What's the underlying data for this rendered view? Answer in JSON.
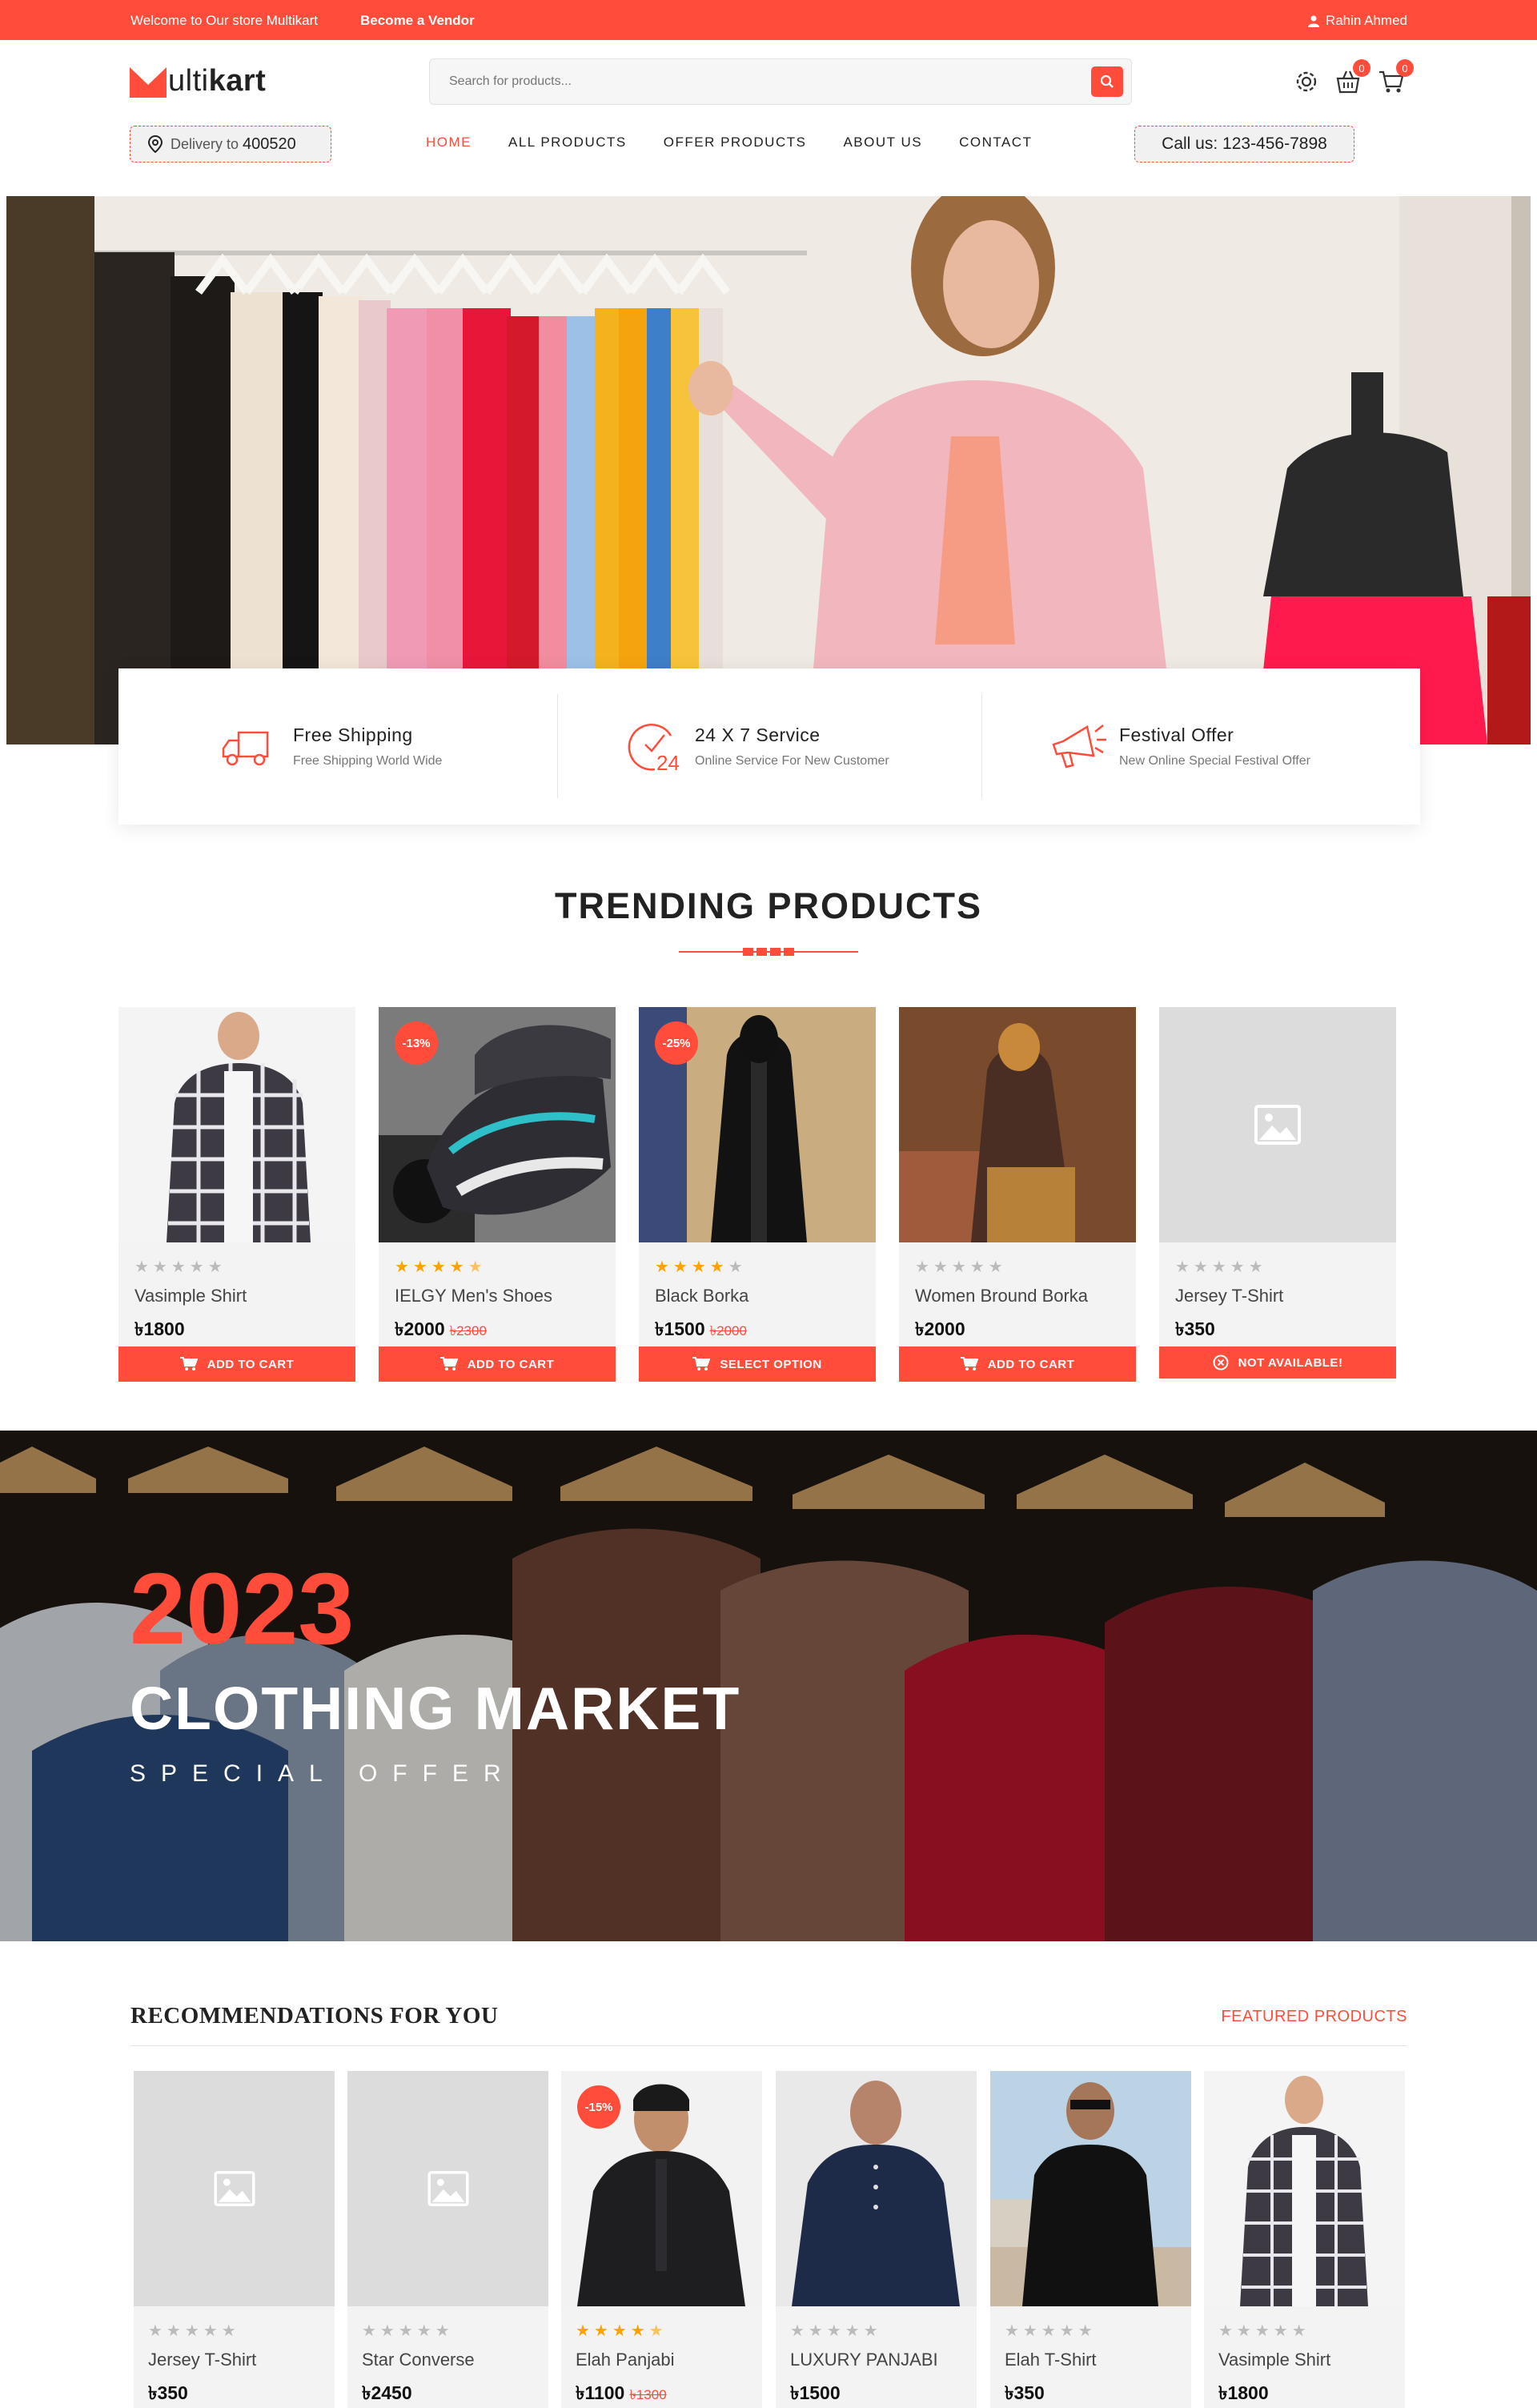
{
  "topbar": {
    "welcome": "Welcome to Our store Multikart",
    "vendor": "Become a Vendor",
    "user": "Rahin Ahmed"
  },
  "header": {
    "logo_mark": "M",
    "logo_text_light": "ulti",
    "logo_text_bold": "kart",
    "search_placeholder": "Search for products...",
    "wishlist_count": "0",
    "cart_count": "0",
    "delivery_label": "Delivery to",
    "delivery_code": "400520",
    "call": "Call us: 123-456-7898"
  },
  "nav": [
    "HOME",
    "ALL PRODUCTS",
    "OFFER PRODUCTS",
    "ABOUT US",
    "CONTACT"
  ],
  "services": [
    {
      "title": "Free Shipping",
      "sub": "Free Shipping World Wide",
      "icon": "truck-icon"
    },
    {
      "title": "24 X 7 Service",
      "sub": "Online Service For New Customer",
      "icon": "clock-24-icon"
    },
    {
      "title": "Festival Offer",
      "sub": "New Online Special Festival Offer",
      "icon": "megaphone-icon"
    }
  ],
  "trending": {
    "title": "TRENDING PRODUCTS",
    "products": [
      {
        "name": "Vasimple Shirt",
        "price": "৳1800",
        "old": "",
        "discount": "",
        "rating": 0,
        "action": "ADD TO CART"
      },
      {
        "name": "IELGY Men's Shoes",
        "price": "৳2000",
        "old": "৳2300",
        "discount": "-13%",
        "rating": 4.5,
        "action": "ADD TO CART"
      },
      {
        "name": "Black Borka",
        "price": "৳1500",
        "old": "৳2000",
        "discount": "-25%",
        "rating": 4,
        "action": "SELECT OPTION"
      },
      {
        "name": "Women Bround Borka",
        "price": "৳2000",
        "old": "",
        "discount": "",
        "rating": 0,
        "action": "ADD TO CART"
      },
      {
        "name": "Jersey T-Shirt",
        "price": "৳350",
        "old": "",
        "discount": "",
        "rating": 0,
        "action": "NOT AVAILABLE!"
      }
    ]
  },
  "banner": {
    "year": "2023",
    "title": "CLOTHING MARKET",
    "subtitle": "SPECIAL OFFER"
  },
  "recommendations": {
    "title": "RECOMMENDATIONS FOR YOU",
    "featured": "FEATURED PRODUCTS",
    "products": [
      {
        "name": "Jersey T-Shirt",
        "price": "৳350",
        "old": "",
        "discount": "",
        "rating": 0
      },
      {
        "name": "Star Converse",
        "price": "৳2450",
        "old": "",
        "discount": "",
        "rating": 0
      },
      {
        "name": "Elah Panjabi",
        "price": "৳1100",
        "old": "৳1300",
        "discount": "-15%",
        "rating": 4.5
      },
      {
        "name": "LUXURY PANJABI",
        "price": "৳1500",
        "old": "",
        "discount": "",
        "rating": 0
      },
      {
        "name": "Elah T-Shirt",
        "price": "৳350",
        "old": "",
        "discount": "",
        "rating": 0
      },
      {
        "name": "Vasimple Shirt",
        "price": "৳1800",
        "old": "",
        "discount": "",
        "rating": 0
      }
    ]
  },
  "colors": {
    "accent": "#ff4c3b",
    "star": "#ffa200"
  }
}
